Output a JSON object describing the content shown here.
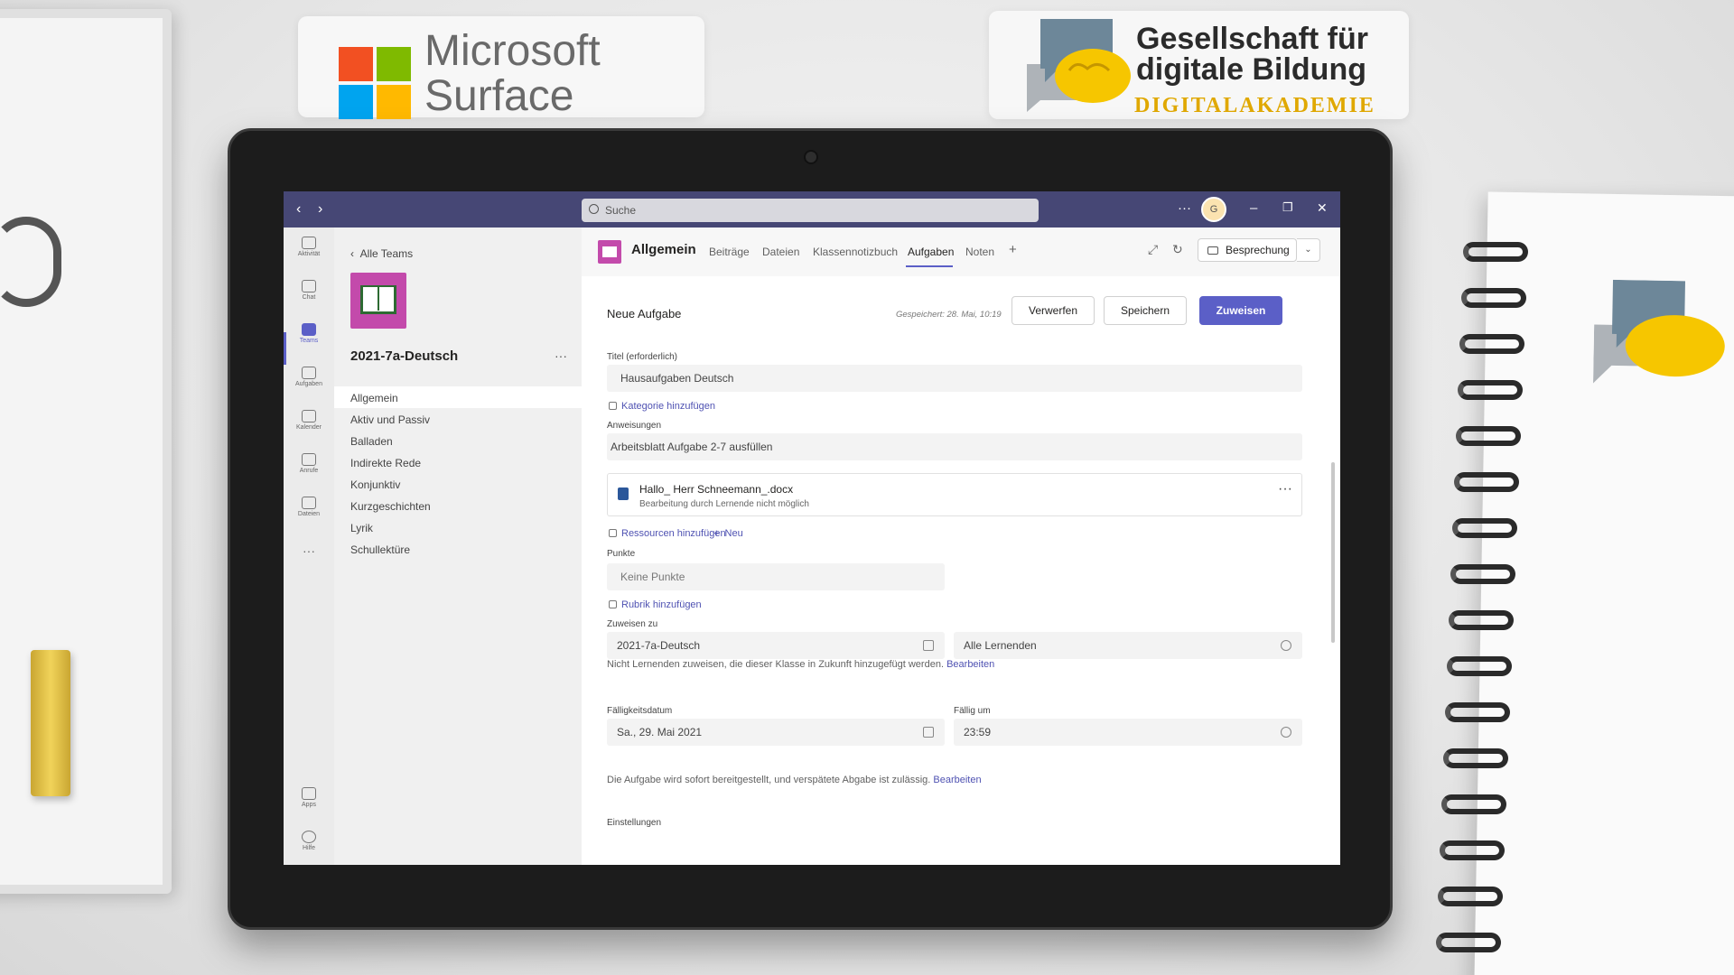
{
  "background": {
    "logo_left": {
      "line1": "Microsoft",
      "line2": "Surface"
    },
    "logo_right": {
      "line1": "Gesellschaft für",
      "line2": "digitale Bildung",
      "line3": "DIGITALAKADEMIE"
    }
  },
  "colors": {
    "accent": "#5b5fc7",
    "titlebar": "#464775",
    "team_icon": "#c34aab"
  },
  "titlebar": {
    "search_placeholder": "Suche",
    "more": "···",
    "avatar_initial": "G",
    "minimize": "–",
    "maximize": "❐",
    "close": "✕"
  },
  "rail": [
    {
      "label": "Aktivität",
      "icon": "bell-icon"
    },
    {
      "label": "Chat",
      "icon": "chat-icon"
    },
    {
      "label": "Teams",
      "icon": "teams-icon",
      "active": true
    },
    {
      "label": "Aufgaben",
      "icon": "assignments-icon"
    },
    {
      "label": "Kalender",
      "icon": "calendar-icon"
    },
    {
      "label": "Anrufe",
      "icon": "phone-icon"
    },
    {
      "label": "Dateien",
      "icon": "file-icon"
    },
    {
      "label": "···",
      "icon": "more-icon"
    },
    {
      "label": "Apps",
      "icon": "apps-icon"
    },
    {
      "label": "Hilfe",
      "icon": "help-icon"
    }
  ],
  "team": {
    "back_label": "Alle Teams",
    "name": "2021-7a-Deutsch",
    "more": "···",
    "channels": [
      "Allgemein",
      "Aktiv und Passiv",
      "Balladen",
      "Indirekte Rede",
      "Konjunktiv",
      "Kurzgeschichten",
      "Lyrik",
      "Schullektüre"
    ]
  },
  "channel_header": {
    "title": "Allgemein",
    "tabs": [
      "Beiträge",
      "Dateien",
      "Klassennotizbuch",
      "Aufgaben",
      "Noten"
    ],
    "active_tab": "Aufgaben",
    "add_tab": "+",
    "meeting_label": "Besprechung",
    "meeting_dropdown": "⌄"
  },
  "assignment": {
    "heading": "Neue Aufgabe",
    "saved_text": "Gespeichert: 28. Mai, 10:19",
    "discard_label": "Verwerfen",
    "save_label": "Speichern",
    "assign_label": "Zuweisen",
    "title_label": "Titel (erforderlich)",
    "title_value": "Hausaufgaben Deutsch",
    "add_category": "Kategorie hinzufügen",
    "instructions_label": "Anweisungen",
    "instructions_value": "Arbeitsblatt Aufgabe 2-7 ausfüllen",
    "attachment": {
      "name": "Hallo_ Herr Schneemann_.docx",
      "subtitle": "Bearbeitung durch Lernende nicht möglich",
      "more": "···"
    },
    "add_resources": "Ressourcen hinzufügen",
    "new_label": "Neu",
    "points_label": "Punkte",
    "points_value": "Keine Punkte",
    "add_rubric": "Rubrik hinzufügen",
    "assign_to_label": "Zuweisen zu",
    "assign_class": "2021-7a-Deutsch",
    "assign_students": "Alle Lernenden",
    "future_note": "Nicht Lernenden zuweisen, die dieser Klasse in Zukunft hinzugefügt werden.",
    "edit_link": "Bearbeiten",
    "due_date_label": "Fälligkeitsdatum",
    "due_date_value": "Sa., 29. Mai 2021",
    "due_time_label": "Fällig um",
    "due_time_value": "23:59",
    "release_note": "Die Aufgabe wird sofort bereitgestellt, und verspätete Abgabe ist zulässig.",
    "release_edit_link": "Bearbeiten",
    "settings_label": "Einstellungen"
  }
}
